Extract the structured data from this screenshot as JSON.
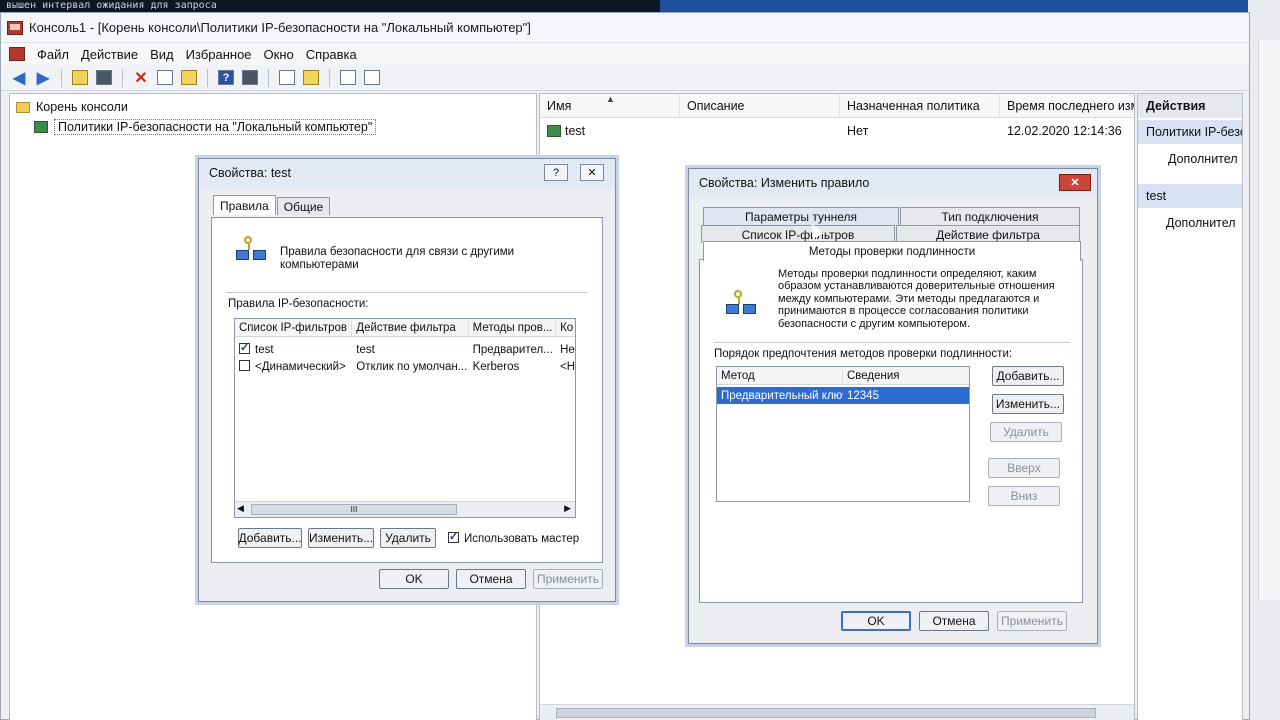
{
  "terminal_text": "вышен интервал ожидания для запроса",
  "window": {
    "title": "Консоль1 - [Корень консоли\\Политики IP-безопасности на \"Локальный компьютер\"]"
  },
  "menu": [
    "Файл",
    "Действие",
    "Вид",
    "Избранное",
    "Окно",
    "Справка"
  ],
  "toolbar": {
    "icons": [
      "back-arrow",
      "forward-arrow",
      "up-folder",
      "show-tree",
      "delete",
      "properties",
      "export",
      "help",
      "show-action-pane",
      "new-policy",
      "manage-filters",
      "assign",
      "unassign"
    ]
  },
  "tree": {
    "root": "Корень консоли",
    "child": "Политики IP-безопасности на \"Локальный компьютер\""
  },
  "list": {
    "columns": [
      "Имя",
      "Описание",
      "Назначенная политика",
      "Время последнего изм"
    ],
    "rows": [
      {
        "name": "test",
        "description": "",
        "assigned": "Нет",
        "modified": "12.02.2020 12:14:36"
      }
    ]
  },
  "actions": {
    "title": "Действия",
    "group1": "Политики IP-безоп",
    "group1_more": "Дополнител",
    "group2": "test",
    "group2_more": "Дополнител"
  },
  "dialog1": {
    "title": "Свойства: test",
    "help_btn": "?",
    "close_btn": "✕",
    "tabs": [
      "Правила",
      "Общие"
    ],
    "description": "Правила безопасности для связи с другими компьютерами",
    "rules_label": "Правила IP-безопасности:",
    "columns": [
      "Список IP-фильтров",
      "Действие фильтра",
      "Методы пров...",
      "Ко"
    ],
    "rows": [
      {
        "checked": true,
        "filter": "test",
        "action": "test",
        "methods": "Предварител...",
        "extra": "Не"
      },
      {
        "checked": false,
        "filter": "<Динамический>",
        "action": "Отклик по умолчан...",
        "methods": "Kerberos",
        "extra": "<Н"
      }
    ],
    "scroll_mark": "III",
    "add_btn": "Добавить...",
    "edit_btn": "Изменить...",
    "delete_btn": "Удалить",
    "wizard_label": "Использовать мастер",
    "wizard_checked": true,
    "ok": "OK",
    "cancel": "Отмена",
    "apply": "Применить"
  },
  "dialog2": {
    "title": "Свойства: Изменить правило",
    "close_btn": "✕",
    "tabs_row1": [
      "Параметры туннеля",
      "Тип подключения"
    ],
    "tabs_row2": [
      "Список IP-фильтров",
      "Действие фильтра"
    ],
    "active_tab": "Методы проверки подлинности",
    "description": "Методы проверки подлинности определяют, каким образом устанавливаются доверительные отношения между компьютерами. Эти методы предлагаются и принимаются в процессе согласования политики безопасности с другим компьютером.",
    "order_label": "Порядок предпочтения методов проверки подлинности:",
    "columns": [
      "Метод",
      "Сведения"
    ],
    "rows": [
      {
        "method": "Предварительный ключ",
        "details": "12345"
      }
    ],
    "add_btn": "Добавить...",
    "edit_btn": "Изменить...",
    "delete_btn": "Удалить",
    "up_btn": "Вверх",
    "down_btn": "Вниз",
    "ok": "OK",
    "cancel": "Отмена",
    "apply": "Применить"
  }
}
